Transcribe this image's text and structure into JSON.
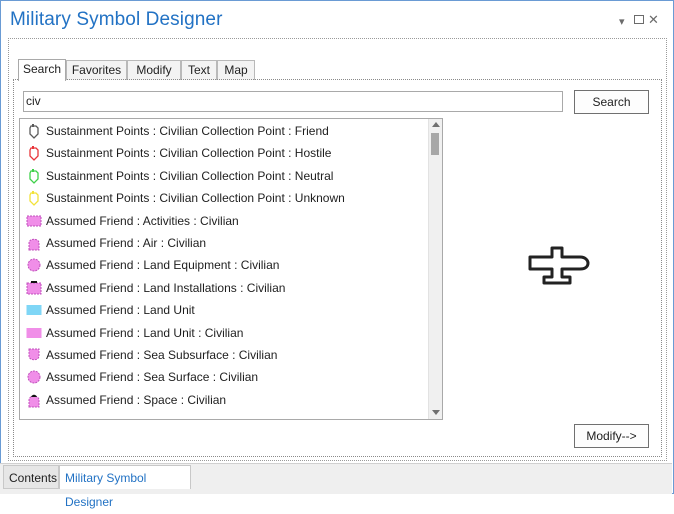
{
  "window": {
    "title": "Military Symbol Designer",
    "controls": {
      "menu": "▾",
      "close": "✕"
    }
  },
  "tabs": [
    {
      "label": "Search",
      "active": true
    },
    {
      "label": "Favorites",
      "active": false
    },
    {
      "label": "Modify",
      "active": false
    },
    {
      "label": "Text",
      "active": false
    },
    {
      "label": "Map",
      "active": false
    }
  ],
  "search": {
    "value": "civ",
    "button_label": "Search"
  },
  "results": [
    {
      "label": "Sustainment Points : Civilian Collection Point : Friend",
      "icon": "point-marker-icon",
      "color": "#5a5a5a"
    },
    {
      "label": "Sustainment Points : Civilian Collection Point : Hostile",
      "icon": "point-marker-icon",
      "color": "#e8353a"
    },
    {
      "label": "Sustainment Points : Civilian Collection Point : Neutral",
      "icon": "point-marker-icon",
      "color": "#3fd14a"
    },
    {
      "label": "Sustainment Points : Civilian Collection Point : Unknown",
      "icon": "point-marker-icon",
      "color": "#f2e23a"
    },
    {
      "label": "Assumed Friend : Activities : Civilian",
      "icon": "dashed-rect-icon",
      "color": "#f08ee8"
    },
    {
      "label": "Assumed Friend : Air : Civilian",
      "icon": "air-dome-icon",
      "color": "#f08ee8"
    },
    {
      "label": "Assumed Friend : Land Equipment : Civilian",
      "icon": "circle-icon",
      "color": "#f08ee8"
    },
    {
      "label": "Assumed Friend : Land Installations : Civilian",
      "icon": "installation-rect-icon",
      "color": "#f08ee8"
    },
    {
      "label": "Assumed Friend : Land Unit",
      "icon": "rect-icon",
      "color": "#7fd6f6"
    },
    {
      "label": "Assumed Friend : Land Unit : Civilian",
      "icon": "rect-icon",
      "color": "#f08ee8"
    },
    {
      "label": "Assumed Friend : Sea Subsurface : Civilian",
      "icon": "subsurface-icon",
      "color": "#f08ee8"
    },
    {
      "label": "Assumed Friend : Sea Surface : Civilian",
      "icon": "circle-icon",
      "color": "#f08ee8"
    },
    {
      "label": "Assumed Friend : Space : Civilian",
      "icon": "space-dome-icon",
      "color": "#f08ee8"
    }
  ],
  "modify_button_label": "Modify-->",
  "bottom_tabs": [
    {
      "label": "Contents",
      "active": false
    },
    {
      "label": "Military Symbol Designer",
      "active": true
    }
  ],
  "colors": {
    "accent": "#2272c4",
    "border": "#6a9bd4"
  }
}
